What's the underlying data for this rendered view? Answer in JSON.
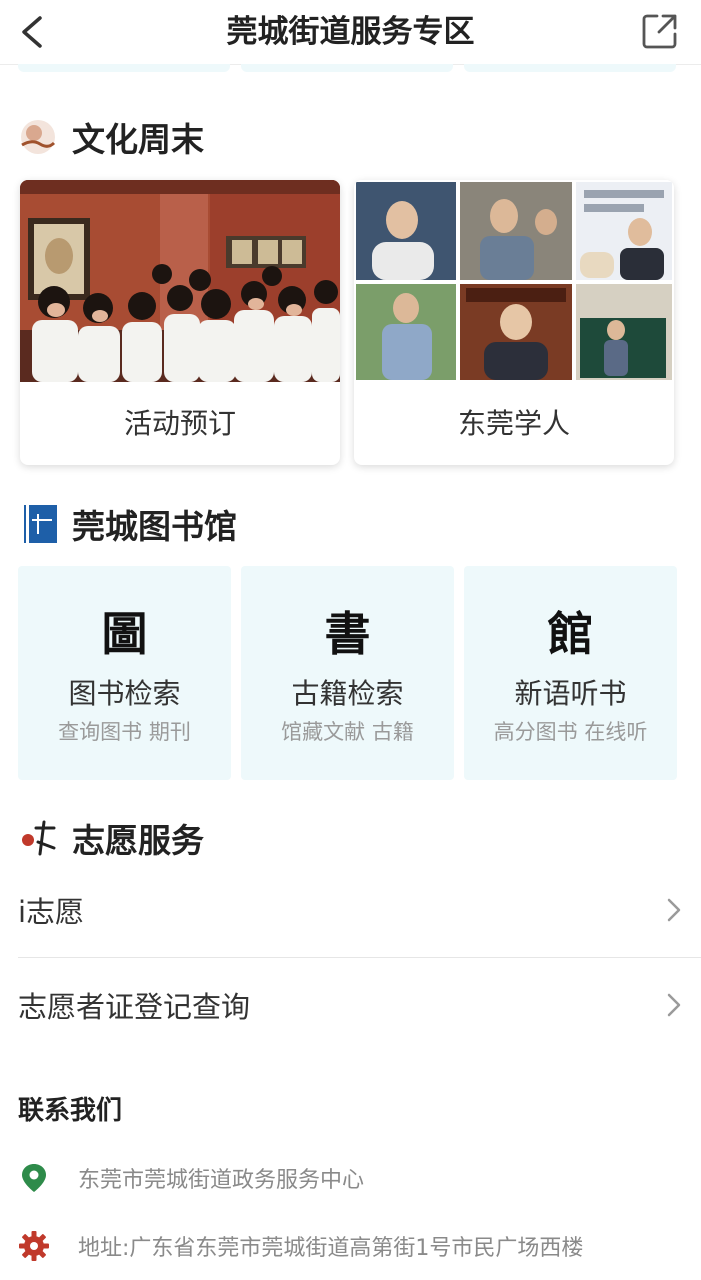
{
  "header": {
    "title": "莞城街道服务专区",
    "back_icon": "chevron-left-icon",
    "share_icon": "external-link-icon"
  },
  "culture": {
    "title": "文化周末",
    "cards": [
      {
        "label": "活动预订"
      },
      {
        "label": "东莞学人"
      }
    ]
  },
  "library": {
    "title": "莞城图书馆",
    "tiles": [
      {
        "glyph": "圖",
        "name": "图书检索",
        "sub": "查询图书 期刊"
      },
      {
        "glyph": "書",
        "name": "古籍检索",
        "sub": "馆藏文献 古籍"
      },
      {
        "glyph": "館",
        "name": "新语听书",
        "sub": "高分图书 在线听"
      }
    ]
  },
  "volunteer": {
    "title": "志愿服务",
    "items": [
      {
        "label": "i志愿"
      },
      {
        "label": "志愿者证登记查询"
      }
    ]
  },
  "contact": {
    "title": "联系我们",
    "items": [
      {
        "text": "东莞市莞城街道政务服务中心",
        "icon": "location-pin-icon"
      },
      {
        "text": "地址:广东省东莞市莞城街道高第街1号市民广场西楼",
        "icon": "gear-icon"
      }
    ]
  },
  "colors": {
    "accent_green": "#2e8b4a",
    "accent_red": "#c0392b",
    "tile_bg": "#eef9fb",
    "library_logo": "#1e5fa8"
  }
}
